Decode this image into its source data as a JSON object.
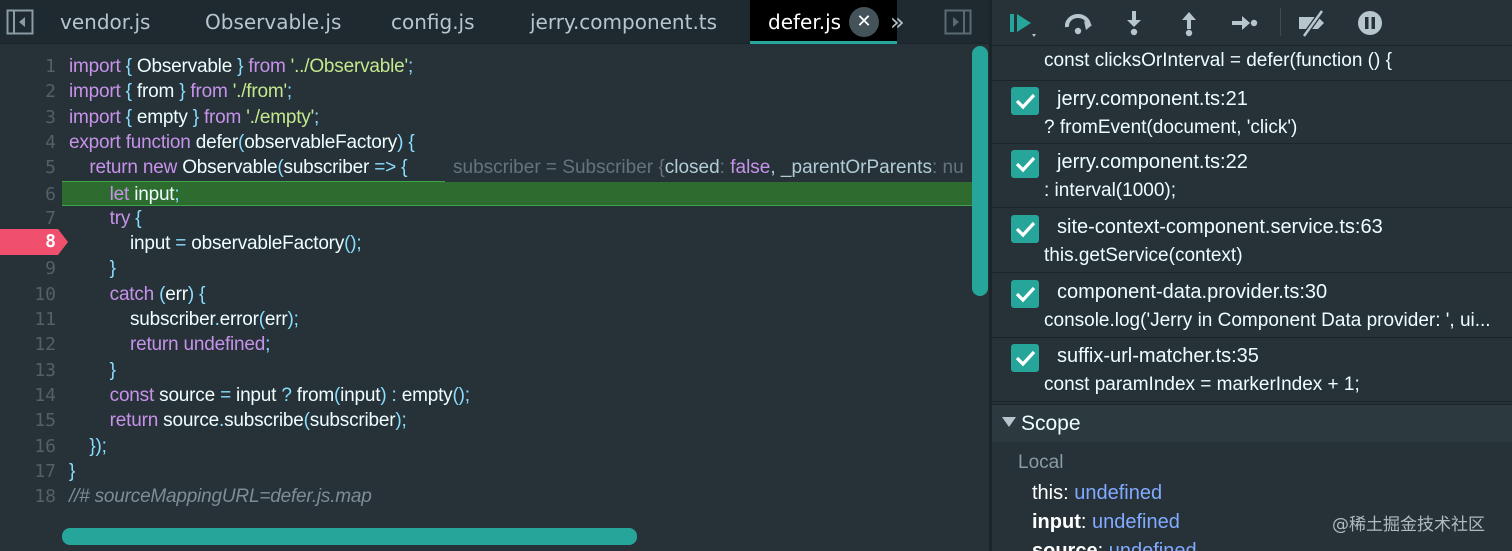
{
  "tabs": [
    {
      "label": "vendor.js"
    },
    {
      "label": "Observable.js"
    },
    {
      "label": "config.js"
    },
    {
      "label": "jerry.component.ts"
    },
    {
      "label": "defer.js",
      "active": true
    }
  ],
  "tab_close_glyph": "✕",
  "more_tabs_glyph": "»",
  "editor": {
    "current_line": 6,
    "breakpoint_line": "8",
    "inline_hint": {
      "prefix": "subscriber = Subscriber {",
      "key1": "closed",
      "sep1": ": ",
      "val1": "false",
      "sep2": ", _parentOrParents",
      "sep3": ": nu"
    },
    "lines": [
      {
        "n": "1"
      },
      {
        "n": "2"
      },
      {
        "n": "3"
      },
      {
        "n": "4"
      },
      {
        "n": "5"
      },
      {
        "n": "6"
      },
      {
        "n": "7"
      },
      {
        "n": "8"
      },
      {
        "n": "9"
      },
      {
        "n": "10"
      },
      {
        "n": "11"
      },
      {
        "n": "12"
      },
      {
        "n": "13"
      },
      {
        "n": "14"
      },
      {
        "n": "15"
      },
      {
        "n": "16"
      },
      {
        "n": "17"
      },
      {
        "n": "18"
      }
    ],
    "code": {
      "l1": [
        "import",
        " { ",
        "Observable",
        " } ",
        "from",
        " '../Observable'",
        ";"
      ],
      "l2": [
        "import",
        " { ",
        "from",
        " } ",
        "from",
        " './from'",
        ";"
      ],
      "l3": [
        "import",
        " { ",
        "empty",
        " } ",
        "from",
        " './empty'",
        ";"
      ],
      "l4": [
        "export",
        " ",
        "function",
        " defer",
        "(",
        "observableFactory",
        ")",
        " {"
      ],
      "l5": [
        "    ",
        "return",
        " ",
        "new",
        " Observable",
        "(",
        "subscriber",
        " => {"
      ],
      "l6": [
        "        ",
        "let",
        " input",
        ";"
      ],
      "l7": [
        "        ",
        "try",
        " {"
      ],
      "l8": [
        "            ",
        "input",
        " = ",
        "observableFactory",
        "();"
      ],
      "l9": [
        "        ",
        "}"
      ],
      "l10": [
        "        ",
        "catch",
        " (",
        "err",
        ") {"
      ],
      "l11": [
        "            ",
        "subscriber",
        ".",
        "error",
        "(",
        "err",
        ");"
      ],
      "l12": [
        "            ",
        "return",
        " ",
        "undefined",
        ";"
      ],
      "l13": [
        "        ",
        "}"
      ],
      "l14": [
        "        ",
        "const",
        " source",
        " = ",
        "input",
        " ? ",
        "from",
        "(",
        "input",
        ")",
        " : ",
        "empty",
        "();"
      ],
      "l15": [
        "        ",
        "return",
        " source",
        ".",
        "subscribe",
        "(",
        "subscriber",
        ");"
      ],
      "l16": [
        "    ",
        "});"
      ],
      "l17": [
        "}"
      ],
      "l18": [
        "//# sourceMappingURL=defer.js.map"
      ]
    }
  },
  "debugger": {
    "toolbar": [
      {
        "name": "resume-icon"
      },
      {
        "name": "step-over-icon"
      },
      {
        "name": "step-into-icon"
      },
      {
        "name": "step-out-icon"
      },
      {
        "name": "step-icon"
      },
      {
        "name": "deactivate-breakpoints-icon"
      },
      {
        "name": "pause-on-exceptions-icon"
      }
    ],
    "top_partial_code": "const clicksOrInterval = defer(function () {",
    "breakpoints": [
      {
        "file": "jerry.component.ts:21",
        "code": "? fromEvent(document, 'click')",
        "checked": true
      },
      {
        "file": "jerry.component.ts:22",
        "code": ": interval(1000);",
        "checked": true
      },
      {
        "file": "site-context-component.service.ts:63",
        "code": "this.getService(context)",
        "checked": true
      },
      {
        "file": "component-data.provider.ts:30",
        "code": "console.log('Jerry in Component Data provider: ', ui...",
        "checked": true
      },
      {
        "file": "suffix-url-matcher.ts:35",
        "code": "const paramIndex = markerIndex + 1;",
        "checked": true
      }
    ],
    "scope": {
      "title": "Scope",
      "local_label": "Local",
      "vars": [
        {
          "name": "this",
          "sep": ": ",
          "value": "undefined"
        },
        {
          "name": "input",
          "sep": ": ",
          "value": "undefined"
        },
        {
          "name": "source",
          "sep": ": ",
          "value": "undefined"
        }
      ]
    }
  },
  "watermark": "@稀土掘金技术社区",
  "colors": {
    "accent": "#26a69a",
    "keyword": "#c792ea",
    "string": "#c3e88d",
    "punctuation": "#89ddff",
    "breakpoint": "#f0506e",
    "current_line": "#2e6b2e",
    "value": "#82aaff"
  }
}
